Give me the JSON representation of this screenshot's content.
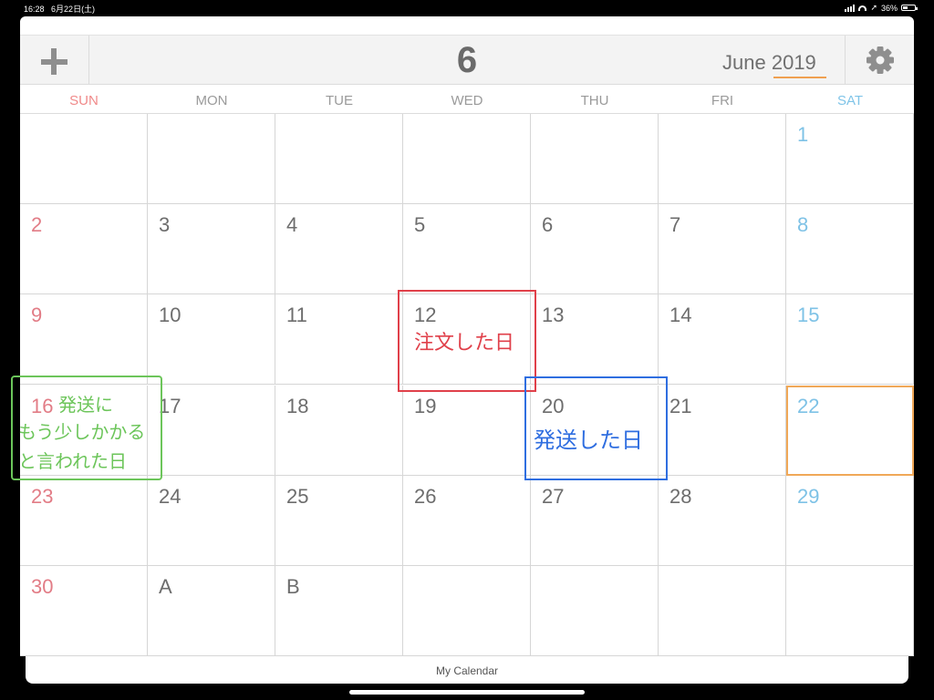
{
  "status_bar": {
    "time": "16:28",
    "date": "6月22日(土)",
    "battery": "36%"
  },
  "header": {
    "month_number": "6",
    "month_name": "June",
    "year": "2019"
  },
  "weekdays": [
    "SUN",
    "MON",
    "TUE",
    "WED",
    "THU",
    "FRI",
    "SAT"
  ],
  "days": [
    [
      "",
      "",
      "",
      "",
      "",
      "",
      "1"
    ],
    [
      "2",
      "3",
      "4",
      "5",
      "6",
      "7",
      "8"
    ],
    [
      "9",
      "10",
      "11",
      "12",
      "13",
      "14",
      "15"
    ],
    [
      "16",
      "17",
      "18",
      "19",
      "20",
      "21",
      "22"
    ],
    [
      "23",
      "24",
      "25",
      "26",
      "27",
      "28",
      "29"
    ],
    [
      "30",
      "A",
      "B",
      "",
      "",
      "",
      ""
    ]
  ],
  "today": "22",
  "annotations": {
    "red": "注文した日",
    "blue": "発送した日",
    "green": [
      "発送に",
      "もう少しかかる",
      "と言われた日"
    ]
  },
  "footer": {
    "calendar_name": "My Calendar"
  },
  "colors": {
    "sunday": "#e27c86",
    "saturday": "#7ec2e6",
    "today_outline": "#f0a858",
    "year_underline": "#f0a050"
  }
}
